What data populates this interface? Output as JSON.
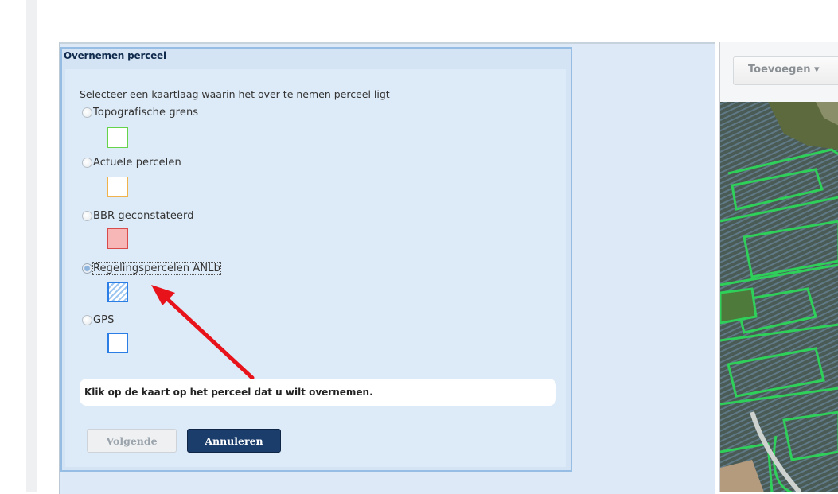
{
  "dialog": {
    "title": "Overnemen perceel",
    "instruction": "Selecteer een kaartlaag waarin het over te nemen perceel ligt",
    "options": [
      {
        "label": "Topografische grens",
        "selected": false,
        "swatch": {
          "border": "#66d44a",
          "fill": "#ffffff",
          "pattern": "none"
        }
      },
      {
        "label": "Actuele percelen",
        "selected": false,
        "swatch": {
          "border": "#f0b24a",
          "fill": "#ffffff",
          "pattern": "none"
        }
      },
      {
        "label": "BBR geconstateerd",
        "selected": false,
        "swatch": {
          "border": "#d94a4a",
          "fill": "#f7b7b7",
          "pattern": "none"
        }
      },
      {
        "label": "Regelingspercelen ANLb",
        "selected": true,
        "swatch": {
          "border": "#2a7ee6",
          "fill": "#ffffff",
          "pattern": "hatch"
        }
      },
      {
        "label": "GPS",
        "selected": false,
        "swatch": {
          "border": "#2a7ee6",
          "fill": "#ffffff",
          "pattern": "none"
        }
      }
    ],
    "hint": "Klik op de kaart op het perceel dat u wilt overnemen.",
    "buttons": {
      "next": "Volgende",
      "cancel": "Annuleren"
    }
  },
  "map": {
    "toolbar": {
      "add_label": "Toevoegen ▾"
    }
  },
  "colors": {
    "annotation_arrow": "#e8121a",
    "cancel_button": "#1b3d6c",
    "dialog_border": "#96bde3"
  }
}
